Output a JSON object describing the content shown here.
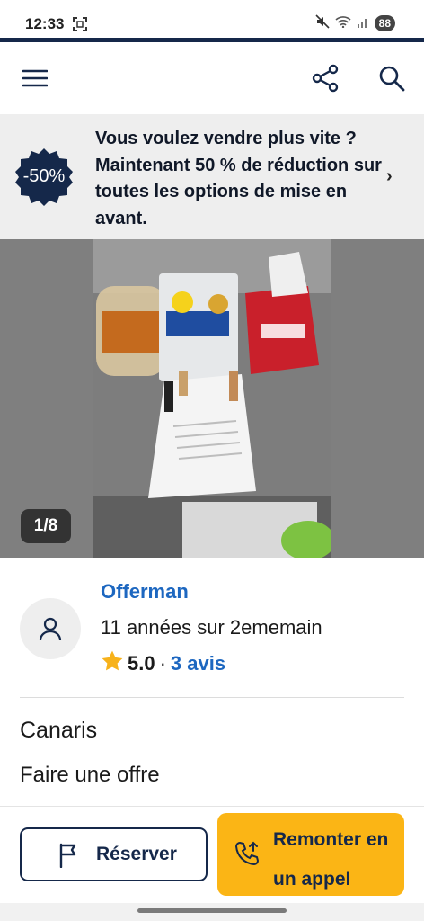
{
  "status_bar": {
    "time": "12:33",
    "battery": "88"
  },
  "header": {
    "icons": [
      "menu-icon",
      "share-icon",
      "search-icon"
    ]
  },
  "promo": {
    "badge": "-50%",
    "text": "Vous voulez vendre plus vite ? Maintenant 50 % de réduction sur toutes les options de mise en avant.",
    "chevron": "›"
  },
  "gallery": {
    "counter": "1/8"
  },
  "seller": {
    "name": "Offerman",
    "tenure": "11 années sur 2ememain",
    "rating": "5.0",
    "separator": "·",
    "reviews": "3 avis"
  },
  "listing": {
    "title": "Canaris",
    "offer_link": "Faire une offre"
  },
  "actions": {
    "reserve_label": "Réserver",
    "call_label": "Remonter en un appel"
  },
  "colors": {
    "navy": "#15284a",
    "link_blue": "#1d67c0",
    "call_yellow": "#fbb515",
    "star": "#f7b21b"
  }
}
